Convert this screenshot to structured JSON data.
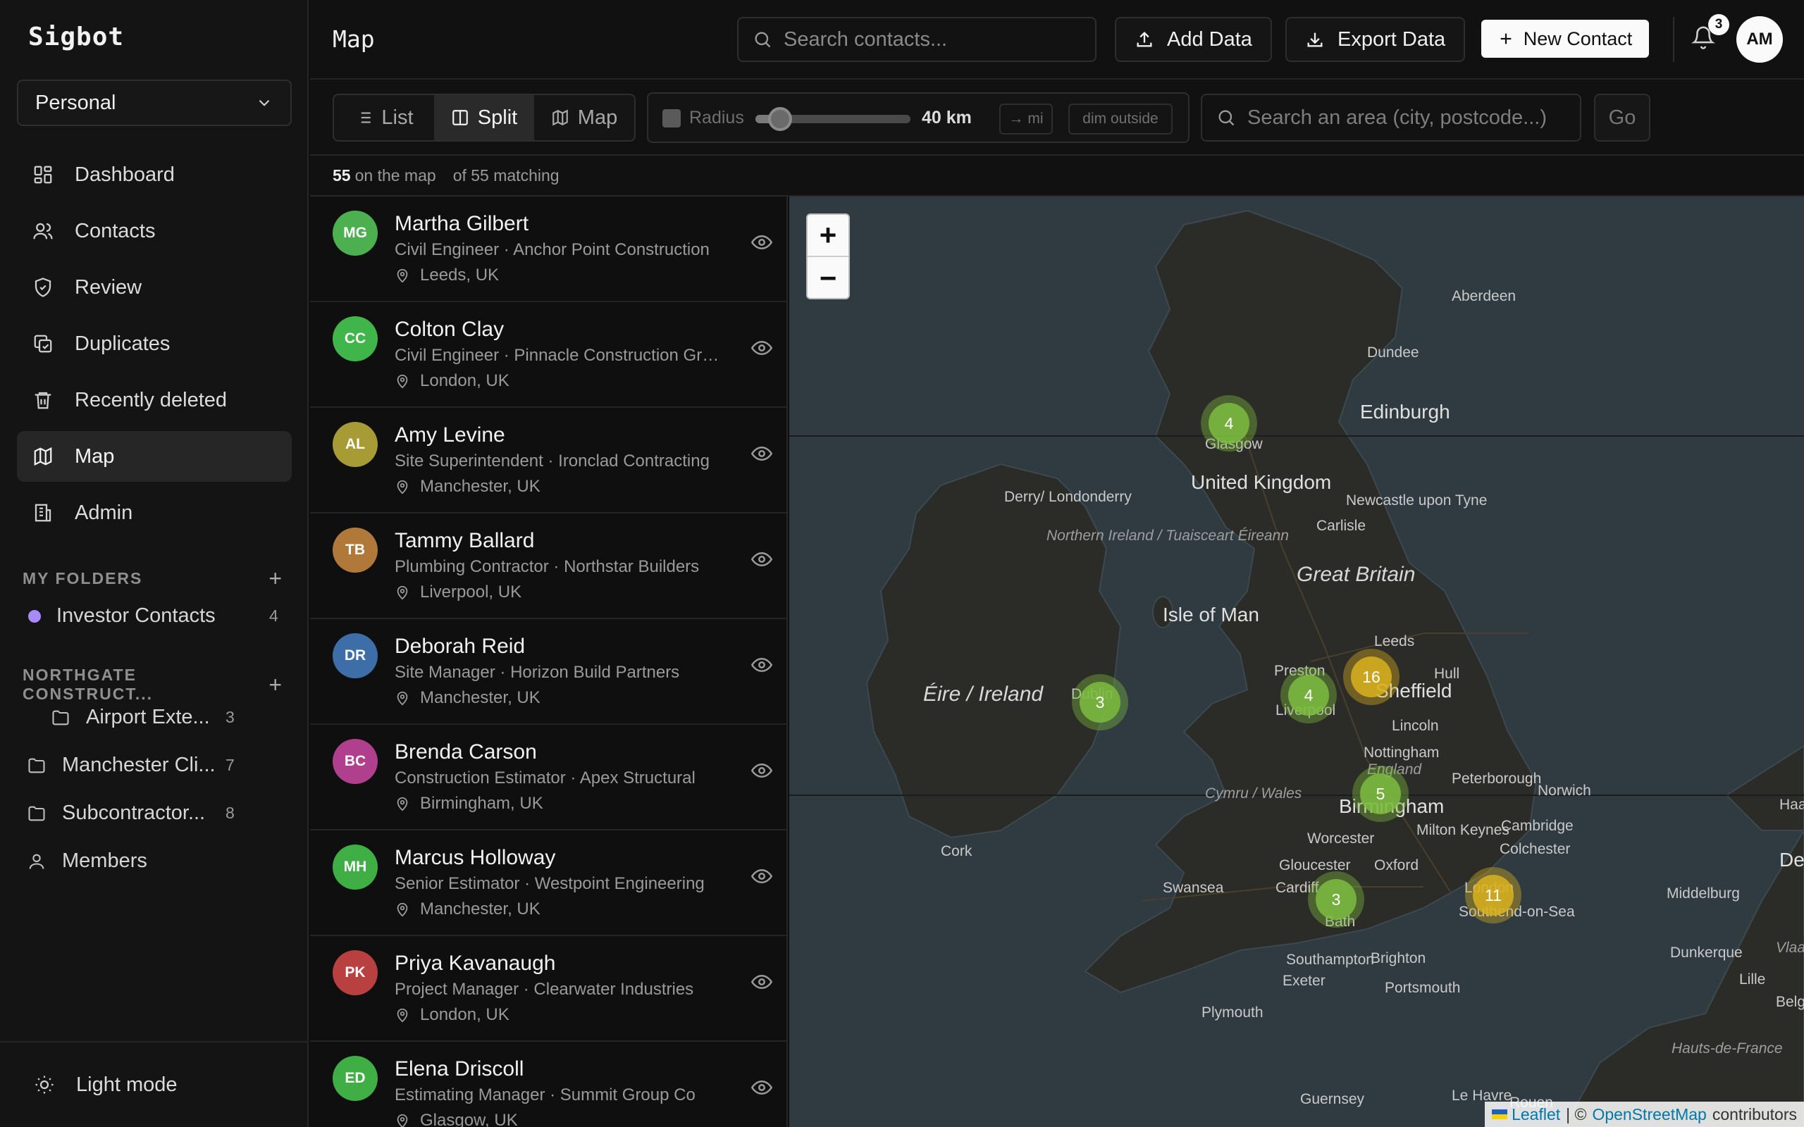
{
  "app": {
    "brand": "Sigbot",
    "page_title": "Map"
  },
  "workspace": {
    "selected": "Personal"
  },
  "nav": [
    {
      "label": "Dashboard",
      "icon": "dashboard-icon"
    },
    {
      "label": "Contacts",
      "icon": "users-icon"
    },
    {
      "label": "Review",
      "icon": "shield-check-icon"
    },
    {
      "label": "Duplicates",
      "icon": "duplicate-icon"
    },
    {
      "label": "Recently deleted",
      "icon": "trash-icon"
    },
    {
      "label": "Map",
      "icon": "map-icon",
      "active": true
    },
    {
      "label": "Admin",
      "icon": "building-icon"
    }
  ],
  "folders": {
    "my_heading": "MY FOLDERS",
    "my_items": [
      {
        "label": "Investor Contacts",
        "count": "4",
        "color": "#a78bfa"
      }
    ],
    "org_heading": "NORTHGATE CONSTRUCT...",
    "org_items": [
      {
        "label": "Airport Exte...",
        "count": "3"
      },
      {
        "label": "Manchester Cli...",
        "count": "7"
      },
      {
        "label": "Subcontractor...",
        "count": "8"
      }
    ],
    "members_label": "Members"
  },
  "theme_toggle": "Light mode",
  "header": {
    "search_placeholder": "Search contacts...",
    "add_data": "Add Data",
    "export_data": "Export Data",
    "new_contact": "New Contact",
    "notifications_count": "3",
    "user_initials": "AM"
  },
  "toolbar": {
    "views": [
      "List",
      "Split",
      "Map"
    ],
    "active_view": "Split",
    "radius_label": "Radius",
    "radius_value": "40 km",
    "radius_fraction": 0.16,
    "unit_toggle": "→ mi",
    "dim_toggle": "dim outside",
    "area_placeholder": "Search an area (city, postcode...)",
    "go": "Go"
  },
  "counts": {
    "on_map": "55",
    "on_map_suffix": "on the map",
    "matching": "of 55 matching"
  },
  "contacts": [
    {
      "initials": "MG",
      "name": "Martha Gilbert",
      "sub": "Civil Engineer · Anchor Point Construction",
      "loc": "Leeds, UK",
      "color": "#4caf50"
    },
    {
      "initials": "CC",
      "name": "Colton Clay",
      "sub": "Civil Engineer · Pinnacle Construction Group",
      "loc": "London, UK",
      "color": "#3fb54a"
    },
    {
      "initials": "AL",
      "name": "Amy Levine",
      "sub": "Site Superintendent · Ironclad Contracting",
      "loc": "Manchester, UK",
      "color": "#a69b35"
    },
    {
      "initials": "TB",
      "name": "Tammy Ballard",
      "sub": "Plumbing Contractor · Northstar Builders",
      "loc": "Liverpool, UK",
      "color": "#b0793a"
    },
    {
      "initials": "DR",
      "name": "Deborah Reid",
      "sub": "Site Manager · Horizon Build Partners",
      "loc": "Manchester, UK",
      "color": "#3e6ea8"
    },
    {
      "initials": "BC",
      "name": "Brenda Carson",
      "sub": "Construction Estimator · Apex Structural",
      "loc": "Birmingham, UK",
      "color": "#b0408e"
    },
    {
      "initials": "MH",
      "name": "Marcus Holloway",
      "sub": "Senior Estimator · Westpoint Engineering",
      "loc": "Manchester, UK",
      "color": "#3fae45"
    },
    {
      "initials": "PK",
      "name": "Priya Kavanaugh",
      "sub": "Project Manager · Clearwater Industries",
      "loc": "London, UK",
      "color": "#b84040"
    },
    {
      "initials": "ED",
      "name": "Elena Driscoll",
      "sub": "Estimating Manager · Summit Group Co",
      "loc": "Glasgow, UK",
      "color": "#3fae45"
    }
  ],
  "map": {
    "clusters": [
      {
        "count": "4",
        "level": "small"
      },
      {
        "count": "3",
        "level": "small"
      },
      {
        "count": "4",
        "level": "small"
      },
      {
        "count": "16",
        "level": "large"
      },
      {
        "count": "5",
        "level": "small"
      },
      {
        "count": "3",
        "level": "small"
      },
      {
        "count": "11",
        "level": "large"
      }
    ],
    "places": [
      "Aberdeen",
      "Dundee",
      "Edinburgh",
      "Glasgow",
      "United Kingdom",
      "Derry/ Londonderry",
      "Northern Ireland / Tuaisceart Éireann",
      "Newcastle upon Tyne",
      "Carlisle",
      "Great Britain",
      "Isle of Man",
      "Leeds",
      "Hull",
      "Preston",
      "Sheffield",
      "Éire / Ireland",
      "Dublin",
      "Liverpool",
      "Lincoln",
      "Nottingham",
      "England",
      "Peterborough",
      "Norwich",
      "Birmingham",
      "Cymru / Wales",
      "Cork",
      "Milton Keynes",
      "Cambridge",
      "Worcester",
      "Colchester",
      "Gloucester",
      "Oxford",
      "Swansea",
      "Cardiff",
      "London",
      "Southend-on-Sea",
      "Bath",
      "Southampton",
      "Brighton",
      "Exeter",
      "Portsmouth",
      "Plymouth",
      "Dunkerque",
      "Middelburg",
      "Den Haag",
      "Lille",
      "Guernsey",
      "Le Havre",
      "Rouen",
      "Vlaanderen",
      "Hauts-de-France",
      "Belg",
      "Haar"
    ],
    "attribution": {
      "leaflet": "Leaflet",
      "sep": "| ©",
      "osm": "OpenStreetMap",
      "suffix": "contributors"
    },
    "colors": {
      "small": "#7cbc3f",
      "large": "#d9b21e",
      "water": "#2f3a41",
      "land": "#2b2b27"
    }
  }
}
